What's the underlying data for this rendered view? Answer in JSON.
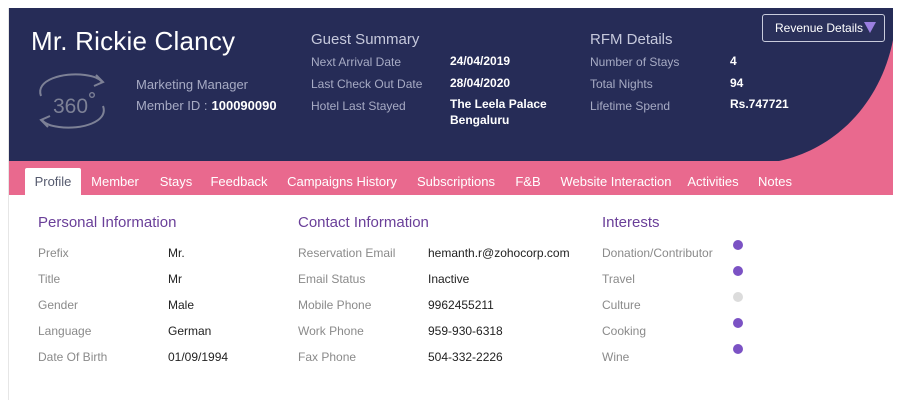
{
  "guest": {
    "name": "Mr. Rickie Clancy",
    "job_title": "Marketing Manager",
    "member_id_label": "Member ID :",
    "member_id": "100090090",
    "icon": "360-view-icon"
  },
  "guest_summary": {
    "title": "Guest Summary",
    "rows": [
      {
        "label": "Next Arrival Date",
        "value": "24/04/2019"
      },
      {
        "label": "Last Check Out Date",
        "value": "28/04/2020"
      },
      {
        "label": "Hotel Last Stayed",
        "value": "The Leela Palace",
        "value2": "Bengaluru"
      }
    ]
  },
  "rfm": {
    "title": "RFM Details",
    "rows": [
      {
        "label": "Number of Stays",
        "value": "4"
      },
      {
        "label": "Total Nights",
        "value": "94"
      },
      {
        "label": "Lifetime Spend",
        "value": "Rs.747721"
      }
    ]
  },
  "revenue_button": {
    "label": "Revenue Details"
  },
  "tabs": [
    {
      "label": "Profile",
      "active": true
    },
    {
      "label": "Member"
    },
    {
      "label": "Stays"
    },
    {
      "label": "Feedback"
    },
    {
      "label": "Campaigns History"
    },
    {
      "label": "Subscriptions"
    },
    {
      "label": "F&B"
    },
    {
      "label": "Website Interaction"
    },
    {
      "label": "Activities"
    },
    {
      "label": "Notes"
    }
  ],
  "personal": {
    "title": "Personal Information",
    "rows": [
      {
        "label": "Prefix",
        "value": "Mr."
      },
      {
        "label": "Title",
        "value": "Mr"
      },
      {
        "label": "Gender",
        "value": "Male"
      },
      {
        "label": "Language",
        "value": "German"
      },
      {
        "label": "Date Of Birth",
        "value": "01/09/1994"
      }
    ]
  },
  "contact": {
    "title": "Contact Information",
    "rows": [
      {
        "label": "Reservation Email",
        "value": "hemanth.r@zohocorp.com"
      },
      {
        "label": "Email Status",
        "value": "Inactive"
      },
      {
        "label": "Mobile Phone",
        "value": "9962455211"
      },
      {
        "label": "Work Phone",
        "value": "959-930-6318"
      },
      {
        "label": "Fax Phone",
        "value": "504-332-2226"
      }
    ]
  },
  "interests": {
    "title": "Interests",
    "items": [
      {
        "label": "Donation/Contributor",
        "active": true
      },
      {
        "label": "Travel",
        "active": true
      },
      {
        "label": "Culture",
        "active": false
      },
      {
        "label": "Cooking",
        "active": true
      },
      {
        "label": "Wine",
        "active": true
      }
    ]
  },
  "colors": {
    "header_navy": "#262c57",
    "header_pink": "#e9698e",
    "accent_purple": "#6a3f99",
    "dot_active": "#7b52c4",
    "dot_inactive": "#dcdcdc"
  }
}
